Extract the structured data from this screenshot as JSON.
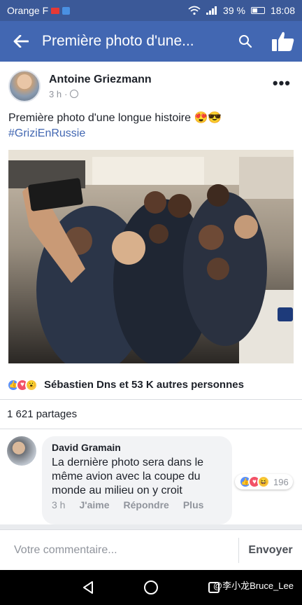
{
  "status_bar": {
    "carrier": "Orange F",
    "battery": "39 %",
    "time": "18:08"
  },
  "app_bar": {
    "title": "Première photo d'une...",
    "back_icon": "arrow-left-icon",
    "search_icon": "search-icon",
    "like_icon": "thumbs-up-icon"
  },
  "post": {
    "author": "Antoine Griezmann",
    "time": "3 h",
    "text": "Première photo d'une longue histoire 😍😎",
    "hashtag": "#GriziEnRussie",
    "more_icon": "more-icon",
    "photo_description_icon": "photo-icon"
  },
  "reactions": {
    "summary": "Sébastien Dns et 53 K autres personnes",
    "types": [
      "like",
      "love",
      "wow"
    ]
  },
  "shares": {
    "label": "1 621 partages"
  },
  "comment": {
    "author": "David Gramain",
    "text": "La dernière photo sera dans le même avion avec la coupe du monde au milieu on y croit",
    "reaction_count": "196",
    "time": "3 h",
    "like_action": "J'aime",
    "reply_action": "Répondre",
    "more_action": "Plus"
  },
  "composer": {
    "placeholder": "Votre commentaire...",
    "send_label": "Envoyer"
  },
  "watermark": "@李小龙Bruce_Lee",
  "colors": {
    "brand": "#4267b2",
    "status_bar": "#3b5998",
    "hashtag": "#4267b2"
  }
}
